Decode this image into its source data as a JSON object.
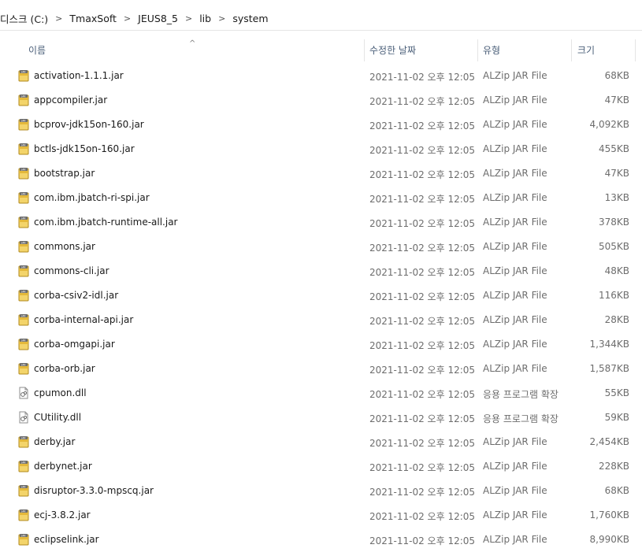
{
  "breadcrumb": [
    "디스크 (C:)",
    "TmaxSoft",
    "JEUS8_5",
    "lib",
    "system"
  ],
  "columns": {
    "name": "이름",
    "date": "수정한 날짜",
    "type": "유형",
    "size": "크기"
  },
  "icons": {
    "sort": "sort-ascending-icon",
    "jar": "jar-file-icon",
    "dll": "dll-file-icon",
    "separator": "chevron-right-icon"
  },
  "files": [
    {
      "name": "activation-1.1.1.jar",
      "date": "2021-11-02 오후 12:05",
      "type": "ALZip JAR File",
      "size": "68KB",
      "kind": "jar"
    },
    {
      "name": "appcompiler.jar",
      "date": "2021-11-02 오후 12:05",
      "type": "ALZip JAR File",
      "size": "47KB",
      "kind": "jar"
    },
    {
      "name": "bcprov-jdk15on-160.jar",
      "date": "2021-11-02 오후 12:05",
      "type": "ALZip JAR File",
      "size": "4,092KB",
      "kind": "jar"
    },
    {
      "name": "bctls-jdk15on-160.jar",
      "date": "2021-11-02 오후 12:05",
      "type": "ALZip JAR File",
      "size": "455KB",
      "kind": "jar"
    },
    {
      "name": "bootstrap.jar",
      "date": "2021-11-02 오후 12:05",
      "type": "ALZip JAR File",
      "size": "47KB",
      "kind": "jar"
    },
    {
      "name": "com.ibm.jbatch-ri-spi.jar",
      "date": "2021-11-02 오후 12:05",
      "type": "ALZip JAR File",
      "size": "13KB",
      "kind": "jar"
    },
    {
      "name": "com.ibm.jbatch-runtime-all.jar",
      "date": "2021-11-02 오후 12:05",
      "type": "ALZip JAR File",
      "size": "378KB",
      "kind": "jar"
    },
    {
      "name": "commons.jar",
      "date": "2021-11-02 오후 12:05",
      "type": "ALZip JAR File",
      "size": "505KB",
      "kind": "jar"
    },
    {
      "name": "commons-cli.jar",
      "date": "2021-11-02 오후 12:05",
      "type": "ALZip JAR File",
      "size": "48KB",
      "kind": "jar"
    },
    {
      "name": "corba-csiv2-idl.jar",
      "date": "2021-11-02 오후 12:05",
      "type": "ALZip JAR File",
      "size": "116KB",
      "kind": "jar"
    },
    {
      "name": "corba-internal-api.jar",
      "date": "2021-11-02 오후 12:05",
      "type": "ALZip JAR File",
      "size": "28KB",
      "kind": "jar"
    },
    {
      "name": "corba-omgapi.jar",
      "date": "2021-11-02 오후 12:05",
      "type": "ALZip JAR File",
      "size": "1,344KB",
      "kind": "jar"
    },
    {
      "name": "corba-orb.jar",
      "date": "2021-11-02 오후 12:05",
      "type": "ALZip JAR File",
      "size": "1,587KB",
      "kind": "jar"
    },
    {
      "name": "cpumon.dll",
      "date": "2021-11-02 오후 12:05",
      "type": "응용 프로그램 확장",
      "size": "55KB",
      "kind": "dll"
    },
    {
      "name": "CUtility.dll",
      "date": "2021-11-02 오후 12:05",
      "type": "응용 프로그램 확장",
      "size": "59KB",
      "kind": "dll"
    },
    {
      "name": "derby.jar",
      "date": "2021-11-02 오후 12:05",
      "type": "ALZip JAR File",
      "size": "2,454KB",
      "kind": "jar"
    },
    {
      "name": "derbynet.jar",
      "date": "2021-11-02 오후 12:05",
      "type": "ALZip JAR File",
      "size": "228KB",
      "kind": "jar"
    },
    {
      "name": "disruptor-3.3.0-mpscq.jar",
      "date": "2021-11-02 오후 12:05",
      "type": "ALZip JAR File",
      "size": "68KB",
      "kind": "jar"
    },
    {
      "name": "ecj-3.8.2.jar",
      "date": "2021-11-02 오후 12:05",
      "type": "ALZip JAR File",
      "size": "1,760KB",
      "kind": "jar"
    },
    {
      "name": "eclipselink.jar",
      "date": "2021-11-02 오후 12:05",
      "type": "ALZip JAR File",
      "size": "8,990KB",
      "kind": "jar"
    }
  ]
}
